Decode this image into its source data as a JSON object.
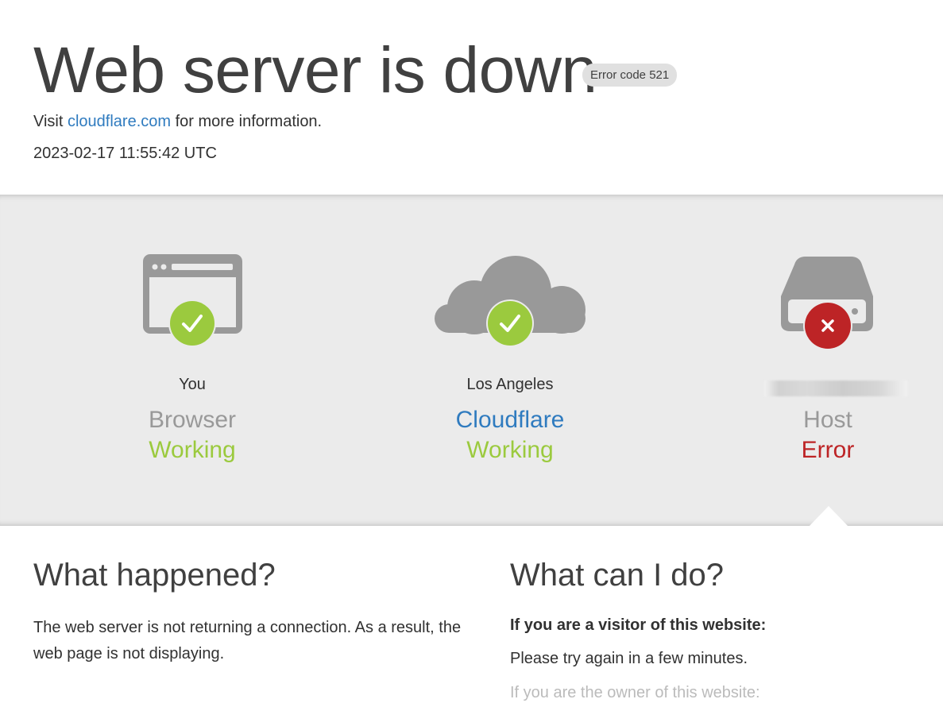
{
  "header": {
    "title": "Web server is down",
    "error_badge": "Error code 521",
    "visit_prefix": "Visit ",
    "visit_link": "cloudflare.com",
    "visit_suffix": " for more information.",
    "timestamp": "2023-02-17 11:55:42 UTC"
  },
  "status": {
    "nodes": [
      {
        "location": "You",
        "name": "Browser",
        "status": "Working",
        "icon": "browser-window-icon",
        "badge_icon": "check-icon"
      },
      {
        "location": "Los Angeles",
        "name": "Cloudflare",
        "status": "Working",
        "icon": "cloud-icon",
        "badge_icon": "check-icon"
      },
      {
        "location": "",
        "name": "Host",
        "status": "Error",
        "icon": "server-drive-icon",
        "badge_icon": "x-icon"
      }
    ]
  },
  "info": {
    "what_happened": {
      "heading": "What happened?",
      "text": "The web server is not returning a connection. As a result, the web page is not displaying."
    },
    "what_can_i_do": {
      "heading": "What can I do?",
      "visitor_heading": "If you are a visitor of this website:",
      "visitor_text": "Please try again in a few minutes.",
      "owner_heading_partial": "If you are the owner of this website:"
    }
  },
  "colors": {
    "working": "#9bca3e",
    "error": "#bd2426",
    "link": "#2f7bbf",
    "cloudflare_name": "#2f7bbf",
    "muted_name": "#999999",
    "icon_gray": "#999999"
  }
}
